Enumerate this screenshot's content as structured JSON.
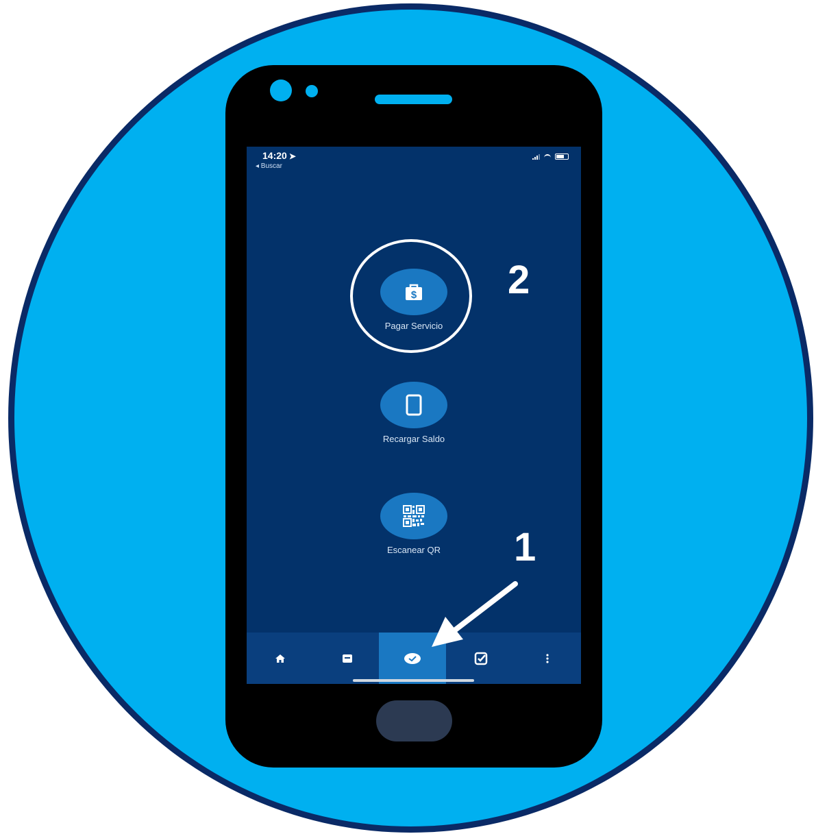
{
  "colors": {
    "background_circle": "#00b0f0",
    "circle_border": "#0a2a66",
    "phone_body": "#000000",
    "screen": "#03326a",
    "action_button": "#1a78c2",
    "tab_bar": "#0a3f7e",
    "tab_active": "#1a78c2",
    "annotation": "#ffffff"
  },
  "status_bar": {
    "time": "14:20",
    "back_label": "◂ Buscar",
    "icons": [
      "signal-icon",
      "wifi-icon",
      "battery-icon"
    ]
  },
  "actions": [
    {
      "label": "Pagar Servicio",
      "icon": "payment-bag-icon",
      "glyph": "$"
    },
    {
      "label": "Recargar Saldo",
      "icon": "mobile-phone-icon"
    },
    {
      "label": "Escanear QR",
      "icon": "qr-code-icon"
    }
  ],
  "tab_bar": {
    "tabs": [
      {
        "icon": "home-icon",
        "active": false
      },
      {
        "icon": "card-icon",
        "active": false
      },
      {
        "icon": "payments-icon",
        "active": true
      },
      {
        "icon": "transfer-icon",
        "active": false
      },
      {
        "icon": "more-icon",
        "active": false
      }
    ]
  },
  "annotations": {
    "step_1": "1",
    "step_2": "2"
  }
}
